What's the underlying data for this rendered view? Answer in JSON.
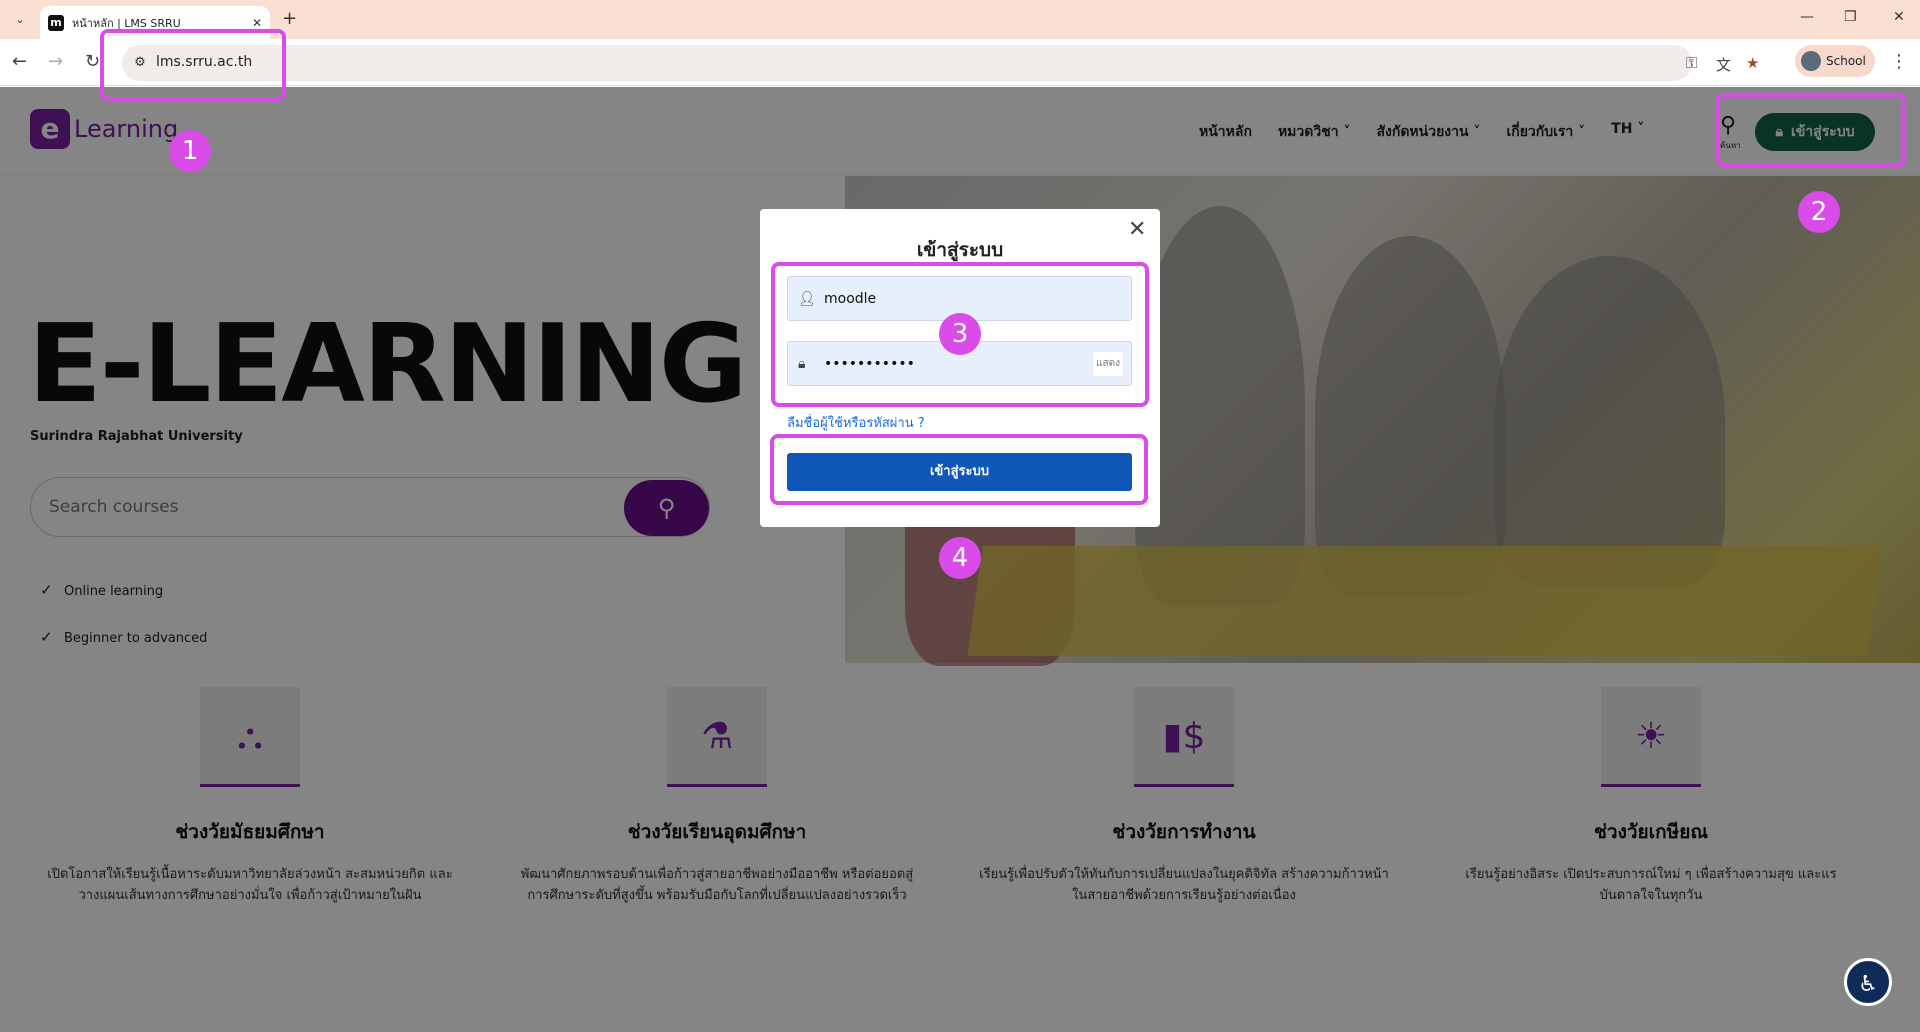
{
  "browser": {
    "tab_title": "หน้าหลัก | LMS SRRU",
    "url": "lms.srru.ac.th",
    "profile_label": "School"
  },
  "header": {
    "logo_mark": "e",
    "logo_text": "Learning",
    "menu": [
      "หน้าหลัก",
      "หมวดวิชา ˅",
      "สังกัดหน่วยงาน ˅",
      "เกี่ยวกับเรา ˅",
      "TH ˅"
    ],
    "search_caption": "ค้นหา",
    "login_label": "เข้าสู่ระบบ"
  },
  "hero": {
    "title": "E-LEARNING",
    "subtitle": "Surindra Rajabhat University",
    "search_placeholder": "Search courses",
    "checks": [
      "Online learning",
      "Beginner to advanced"
    ]
  },
  "features": [
    {
      "title": "ช่วงวัยมัธยมศึกษา",
      "desc1": "เปิดโอกาสให้เรียนรู้เนื้อหาระดับมหาวิทยาลัยล่วงหน้า สะสมหน่วยกิต และ",
      "desc2": "วางแผนเส้นทางการศึกษาอย่างมั่นใจ เพื่อก้าวสู่เป้าหมายในฝัน"
    },
    {
      "title": "ช่วงวัยเรียนอุดมศึกษา",
      "desc1": "พัฒนาศักยภาพรอบด้านเพื่อก้าวสู่สายอาชีพอย่างมืออาชีพ หรือต่อยอดสู่",
      "desc2": "การศึกษาระดับที่สูงขึ้น พร้อมรับมือกับโลกที่เปลี่ยนแปลงอย่างรวดเร็ว"
    },
    {
      "title": "ช่วงวัยการทำงาน",
      "desc1": "เรียนรู้เพื่อปรับตัวให้ทันกับการเปลี่ยนแปลงในยุคดิจิทัล สร้างความก้าวหน้า",
      "desc2": "ในสายอาชีพด้วยการเรียนรู้อย่างต่อเนื่อง"
    },
    {
      "title": "ช่วงวัยเกษียณ",
      "desc1": "เรียนรู้อย่างอิสระ เปิดประสบการณ์ใหม่ ๆ เพื่อสร้างความสุข และแร",
      "desc2": "บันดาลใจในทุกวัน"
    }
  ],
  "modal": {
    "title": "เข้าสู่ระบบ",
    "username_value": "moodle",
    "password_value": "•••••••••••",
    "show_label": "แสดง",
    "forgot_label": "ลืมชื่อผู้ใช้หรือรหัสผ่าน ?",
    "submit_label": "เข้าสู่ระบบ"
  },
  "annotations": [
    "1",
    "2",
    "3",
    "4"
  ],
  "colors": {
    "highlight": "#d94ce8",
    "brand": "#7a1fa2",
    "login_green": "#15634c",
    "submit_blue": "#0f57b8"
  }
}
